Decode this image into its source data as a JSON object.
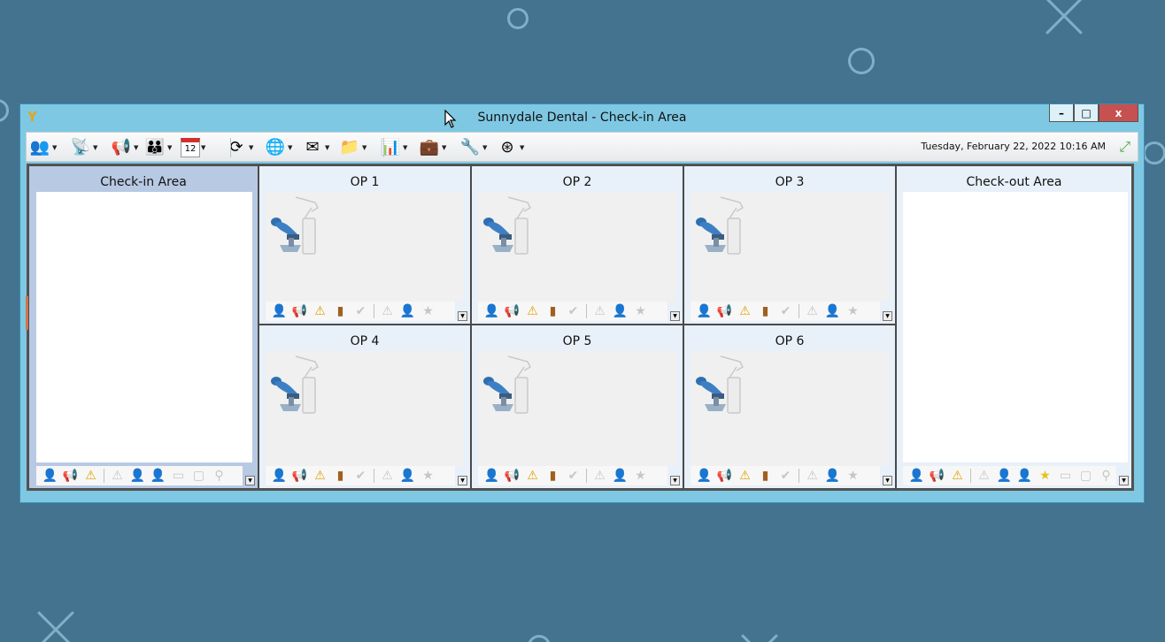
{
  "window": {
    "title": "Sunnydale Dental - Check-in Area",
    "app_icon": "Y",
    "minimize_label": "–",
    "maximize_label": "□",
    "close_label": "x"
  },
  "toolbar": {
    "items": [
      {
        "name": "patients-icon",
        "glyph": "👥",
        "has_dropdown": true
      },
      {
        "name": "tower-icon",
        "glyph": "📡",
        "has_dropdown": true
      },
      {
        "name": "megaphone-icon",
        "glyph": "📢",
        "has_dropdown": true
      },
      {
        "name": "family-icon",
        "glyph": "👪",
        "has_dropdown": true
      },
      {
        "name": "calendar-icon",
        "glyph": "12",
        "has_dropdown": true
      },
      {
        "name": "refresh-icon",
        "glyph": "⟳",
        "has_dropdown": true
      },
      {
        "name": "globe-icon",
        "glyph": "🌐",
        "has_dropdown": true
      },
      {
        "name": "mail-icon",
        "glyph": "✉",
        "has_dropdown": true
      },
      {
        "name": "folder-icon",
        "glyph": "📁",
        "has_dropdown": true
      },
      {
        "name": "chart-icon",
        "glyph": "📊",
        "has_dropdown": true
      },
      {
        "name": "briefcase-icon",
        "glyph": "💼",
        "has_dropdown": true
      },
      {
        "name": "wrench-icon",
        "glyph": "🔧",
        "has_dropdown": true
      },
      {
        "name": "help-lifebuoy-icon",
        "glyph": "⊛",
        "has_dropdown": true
      }
    ],
    "datetime": "Tuesday, February 22, 2022 10:16 AM",
    "expand_icon": "⤢"
  },
  "areas": {
    "checkin": {
      "title": "Check-in Area"
    },
    "checkout": {
      "title": "Check-out Area"
    },
    "ops": [
      {
        "title": "OP 1"
      },
      {
        "title": "OP 2"
      },
      {
        "title": "OP 3"
      },
      {
        "title": "OP 4"
      },
      {
        "title": "OP 5"
      },
      {
        "title": "OP 6"
      }
    ]
  },
  "icon_sets": {
    "area_bar": [
      {
        "name": "patient-icon",
        "glyph": "👤",
        "color": "#2a4f8a",
        "dim": false
      },
      {
        "name": "megaphone-icon",
        "glyph": "📢",
        "color": "#c03030",
        "dim": false
      },
      {
        "name": "warning-icon",
        "glyph": "⚠",
        "color": "#e0a000",
        "dim": false
      },
      {
        "name": "sep"
      },
      {
        "name": "alert-icon",
        "glyph": "⚠",
        "color": "#c6c6c6",
        "dim": true
      },
      {
        "name": "person-icon",
        "glyph": "👤",
        "color": "#9a9a9a",
        "dim": true
      },
      {
        "name": "provider-icon",
        "glyph": "👤",
        "color": "#b0b0b0",
        "dim": true
      },
      {
        "name": "card-icon",
        "glyph": "▭",
        "color": "#c6c6c6",
        "dim": true
      },
      {
        "name": "document-icon",
        "glyph": "▢",
        "color": "#c6c6c6",
        "dim": true
      },
      {
        "name": "search-icon",
        "glyph": "⚲",
        "color": "#c6c6c6",
        "dim": true
      }
    ],
    "checkout_bar": [
      {
        "name": "patient-icon",
        "glyph": "👤",
        "color": "#2a4f8a",
        "dim": false
      },
      {
        "name": "megaphone-icon",
        "glyph": "📢",
        "color": "#c03030",
        "dim": false
      },
      {
        "name": "warning-icon",
        "glyph": "⚠",
        "color": "#e0a000",
        "dim": false
      },
      {
        "name": "sep"
      },
      {
        "name": "alert-icon",
        "glyph": "⚠",
        "color": "#c6c6c6",
        "dim": true
      },
      {
        "name": "person-icon",
        "glyph": "👤",
        "color": "#9a9a9a",
        "dim": true
      },
      {
        "name": "provider-icon",
        "glyph": "👤",
        "color": "#b0b0b0",
        "dim": true
      },
      {
        "name": "star-icon",
        "glyph": "★",
        "color": "#e8c020",
        "dim": false
      },
      {
        "name": "card-icon",
        "glyph": "▭",
        "color": "#c6c6c6",
        "dim": true
      },
      {
        "name": "document-icon",
        "glyph": "▢",
        "color": "#c6c6c6",
        "dim": true
      },
      {
        "name": "search-icon",
        "glyph": "⚲",
        "color": "#c6c6c6",
        "dim": true
      }
    ],
    "op_bar": [
      {
        "name": "patient-icon",
        "glyph": "👤",
        "color": "#2a4f8a",
        "dim": false
      },
      {
        "name": "megaphone-icon",
        "glyph": "📢",
        "color": "#c03030",
        "dim": false
      },
      {
        "name": "warning-icon",
        "glyph": "⚠",
        "color": "#e0a000",
        "dim": false
      },
      {
        "name": "traffic-light-icon",
        "glyph": "▮",
        "color": "#a06020",
        "dim": false
      },
      {
        "name": "check-circle-icon",
        "glyph": "✔",
        "color": "#c6c6c6",
        "dim": true
      },
      {
        "name": "sep"
      },
      {
        "name": "alert-icon",
        "glyph": "⚠",
        "color": "#c6c6c6",
        "dim": true
      },
      {
        "name": "provider-icon",
        "glyph": "👤",
        "color": "#b0b0b0",
        "dim": true
      },
      {
        "name": "star-icon",
        "glyph": "★",
        "color": "#c6c6c6",
        "dim": true
      }
    ]
  }
}
